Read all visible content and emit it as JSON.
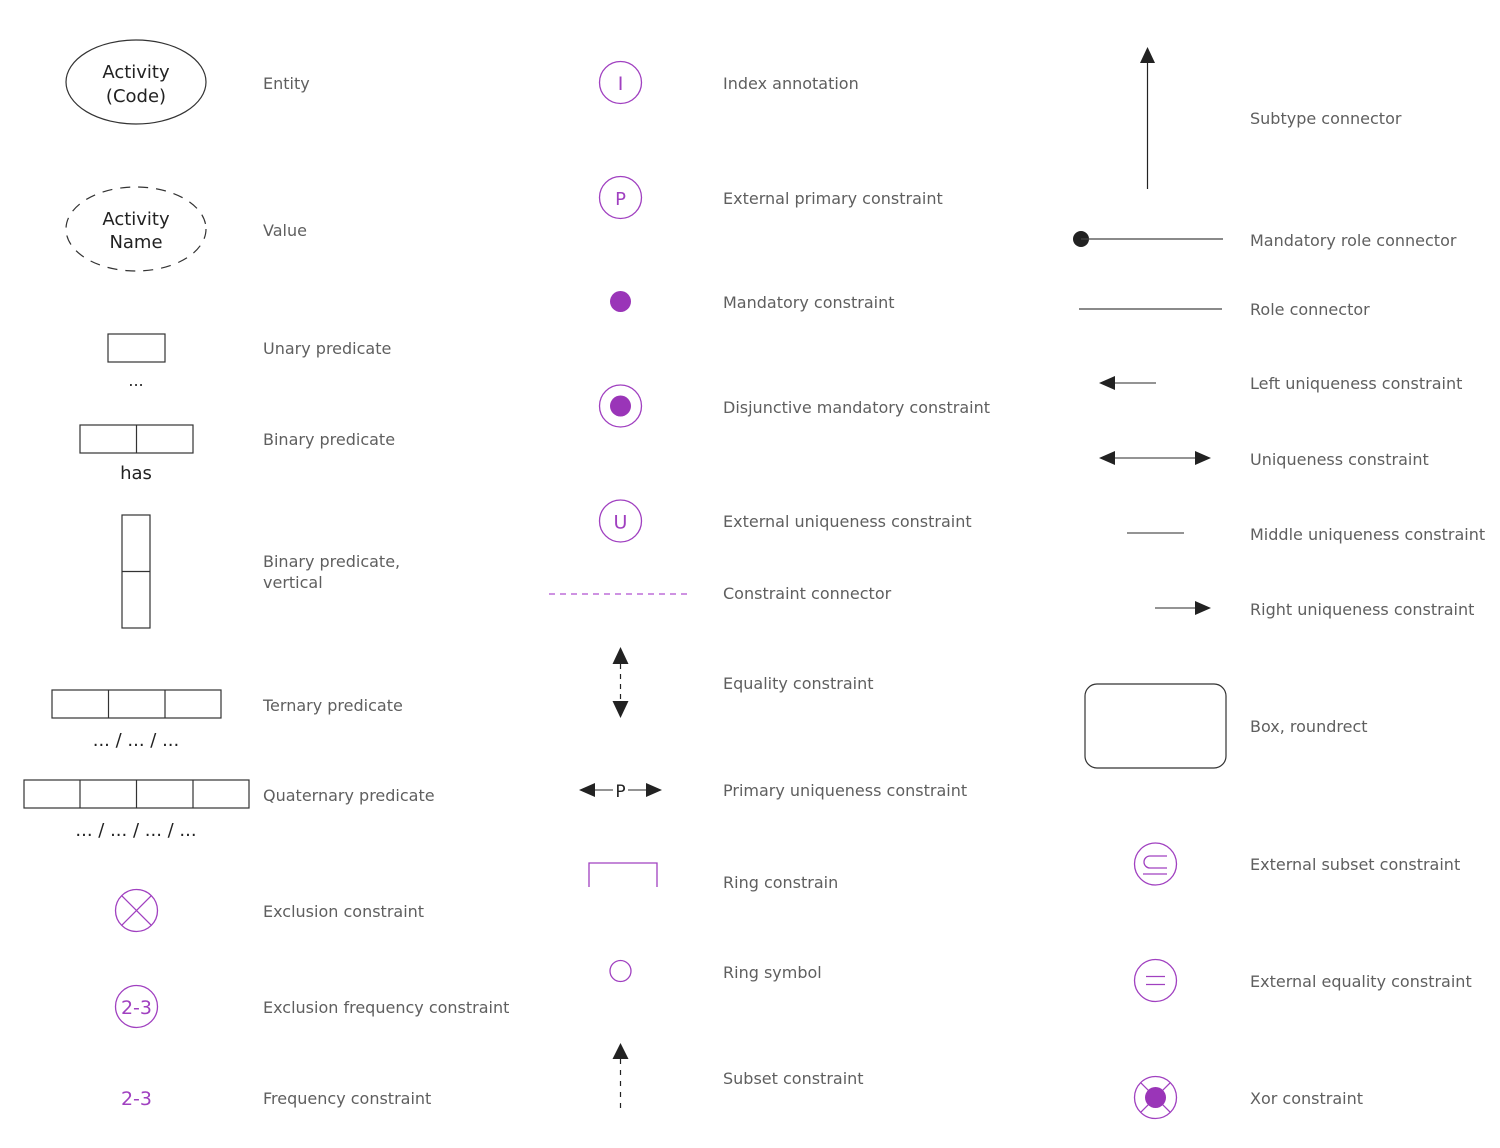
{
  "colors": {
    "label": "#5f5f5f",
    "stroke": "#333333",
    "purple": "#a040c0",
    "purple_fill": "#9a35b8",
    "arrow": "#222222"
  },
  "column1": {
    "entity": {
      "shape_text_line1": "Activity",
      "shape_text_line2": "(Code)",
      "label": "Entity"
    },
    "value": {
      "shape_text_line1": "Activity",
      "shape_text_line2": "Name",
      "label": "Value"
    },
    "unary_predicate": {
      "caption": "...",
      "label": "Unary predicate"
    },
    "binary_predicate": {
      "caption": "has",
      "label": "Binary predicate"
    },
    "binary_predicate_vertical": {
      "label": "Binary predicate,\nvertical"
    },
    "ternary_predicate": {
      "caption": "... / ... / ...",
      "label": "Ternary predicate"
    },
    "quaternary_predicate": {
      "caption": "... / ... / ... / ...",
      "label": "Quaternary predicate"
    },
    "exclusion_constraint": {
      "label": "Exclusion constraint"
    },
    "exclusion_frequency_constraint": {
      "symbol_text": "2-3",
      "label": "Exclusion frequency constraint"
    },
    "frequency_constraint": {
      "symbol_text": "2-3",
      "label": "Frequency constraint"
    }
  },
  "column2": {
    "index_annotation": {
      "symbol_text": "I",
      "label": "Index annotation"
    },
    "external_primary_constraint": {
      "symbol_text": "P",
      "label": "External primary constraint"
    },
    "mandatory_constraint": {
      "label": "Mandatory constraint"
    },
    "disjunctive_mandatory_constraint": {
      "label": "Disjunctive mandatory constraint"
    },
    "external_uniqueness_constraint": {
      "symbol_text": "U",
      "label": "External uniqueness constraint"
    },
    "constraint_connector": {
      "label": "Constraint connector"
    },
    "equality_constraint": {
      "label": "Equality constraint"
    },
    "primary_uniqueness_constraint": {
      "symbol_text": "P",
      "label": "Primary uniqueness constraint"
    },
    "ring_constrain": {
      "label": "Ring constrain"
    },
    "ring_symbol": {
      "label": "Ring symbol"
    },
    "subset_constraint": {
      "label": "Subset constraint"
    }
  },
  "column3": {
    "subtype_connector": {
      "label": "Subtype connector"
    },
    "mandatory_role_connector": {
      "label": "Mandatory role connector"
    },
    "role_connector": {
      "label": "Role connector"
    },
    "left_uniqueness_constraint": {
      "label": "Left uniqueness constraint"
    },
    "uniqueness_constraint": {
      "label": "Uniqueness constraint"
    },
    "middle_uniqueness_constraint": {
      "label": "Middle uniqueness constraint"
    },
    "right_uniqueness_constraint": {
      "label": "Right uniqueness constraint"
    },
    "box_roundrect": {
      "label": "Box, roundrect"
    },
    "external_subset_constraint": {
      "label": "External subset constraint"
    },
    "external_equality_constraint": {
      "label": "External equality constraint"
    },
    "xor_constraint": {
      "label": "Xor constraint"
    }
  }
}
